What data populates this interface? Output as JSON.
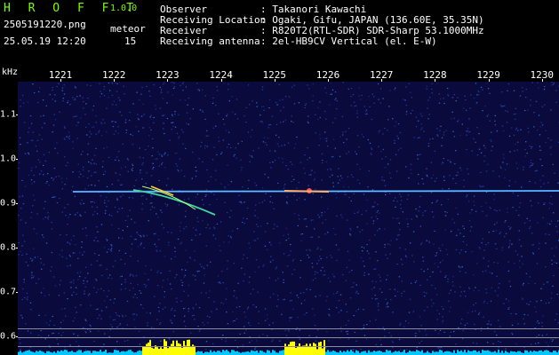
{
  "app": {
    "title": "H R O F F T",
    "version": "1.0.0"
  },
  "file": {
    "name": "2505191220.png",
    "datetime": "25.05.19 12:20"
  },
  "meteor": {
    "label": "meteor",
    "count": "15"
  },
  "info": [
    {
      "key": "Observer",
      "value": ": Takanori Kawachi"
    },
    {
      "key": "Receiving Location",
      "value": ": Ogaki, Gifu, JAPAN (136.60E, 35.35N)"
    },
    {
      "key": "Receiver",
      "value": ": R820T2(RTL-SDR) SDR-Sharp 53.1000MHz"
    },
    {
      "key": "Receiving antenna",
      "value": ": 2el-HB9CV Vertical (el. E-W)"
    }
  ],
  "axes": {
    "y_unit": "kHz",
    "x_ticks": [
      "1221",
      "1222",
      "1223",
      "1224",
      "1225",
      "1226",
      "1227",
      "1228",
      "1229",
      "1230"
    ],
    "y_ticks": [
      "1.1",
      "1.0",
      "0.9",
      "0.8",
      "0.7",
      "0.6"
    ]
  },
  "colors": {
    "title": "#7CFC00",
    "background": "#0a0a3c",
    "signal": "#00c8ff",
    "burst": "#ffff00"
  }
}
